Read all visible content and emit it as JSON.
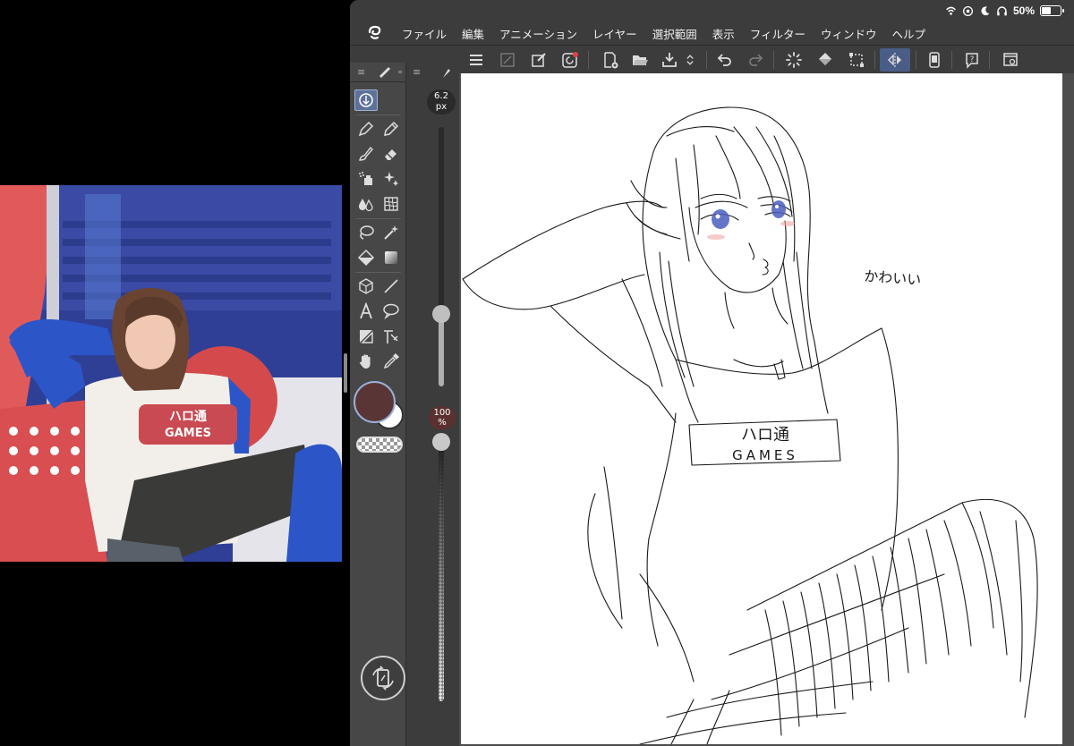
{
  "status_bar": {
    "battery_text": "50%",
    "battery_level": 0.5,
    "icons": [
      "wifi-icon",
      "screen-lock-icon",
      "moon-icon",
      "headphones-icon",
      "battery-icon"
    ]
  },
  "menu": {
    "logo": "clip-studio-logo-icon",
    "items": [
      "ファイル",
      "編集",
      "アニメーション",
      "レイヤー",
      "選択範囲",
      "表示",
      "フィルター",
      "ウィンドウ",
      "ヘルプ"
    ]
  },
  "toolbar": {
    "buttons": [
      "menu-icon",
      "clear-icon",
      "edit-layer-icon",
      "record-timelapse-icon",
      "new-canvas-icon",
      "open-icon",
      "save-icon",
      "more-icon",
      "undo-icon",
      "redo-icon",
      "loading-icon",
      "fill-icon",
      "transform-icon",
      "flip-horizontal-icon",
      "smartphone-icon",
      "help-icon",
      "settings-window-icon"
    ]
  },
  "tool_palette": {
    "tools": [
      "sub-tool-icon",
      "pen-icon",
      "pencil-icon",
      "brush-icon",
      "eraser-icon",
      "airbrush-icon",
      "decoration-icon",
      "blend-icon",
      "liquify-icon",
      "lasso-icon",
      "auto-select-icon",
      "fill-bucket-icon",
      "gradient-icon",
      "3d-object-icon",
      "line-icon",
      "text-icon",
      "balloon-icon",
      "frame-icon",
      "ruler-icon",
      "hand-icon",
      "eyedropper-icon"
    ],
    "main_color": "#5a3535",
    "sub_color": "#ffffff"
  },
  "brush_size": {
    "value": "6.2",
    "unit": "px",
    "level": 0.28
  },
  "opacity": {
    "value": "100",
    "unit": "%",
    "level": 1.0
  },
  "canvas": {
    "handwritten_text": "かわいい",
    "shirt_text_top": "ハロ通",
    "shirt_text_bottom": "GAMES"
  },
  "reference_photo": {
    "shirt_text_top": "ハロ通",
    "shirt_text_bottom": "GAMES"
  },
  "colors": {
    "app_bg": "#3c3c3c",
    "palette_bg": "#474747",
    "accent": "#4a5d86"
  }
}
